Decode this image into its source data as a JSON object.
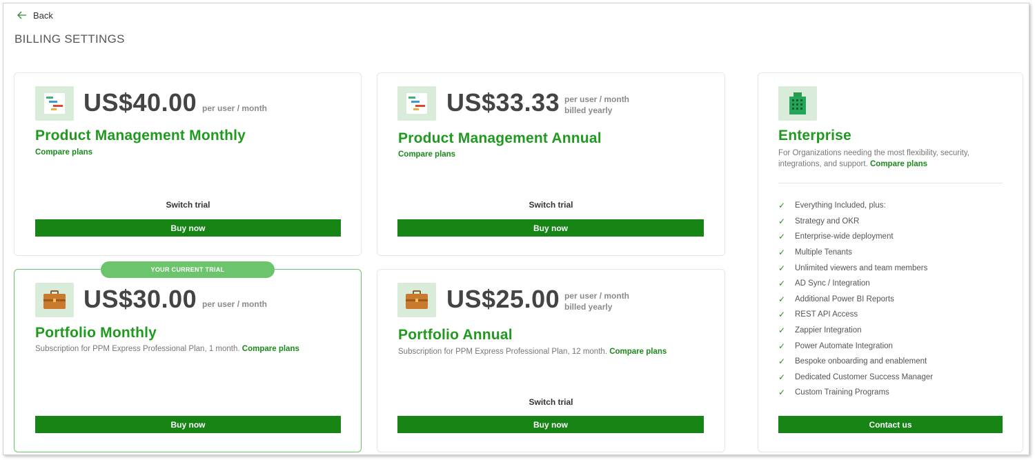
{
  "nav": {
    "back_label": "Back"
  },
  "page": {
    "title": "BILLING SETTINGS"
  },
  "cards": {
    "pm_monthly": {
      "price": "US$40.00",
      "per": "per user / month",
      "title": "Product Management Monthly",
      "compare": "Compare plans",
      "switch": "Switch trial",
      "buy": "Buy now",
      "icon": "gantt-chart-icon"
    },
    "pm_annual": {
      "price": "US$33.33",
      "per": "per user / month",
      "billed": "billed yearly",
      "title": "Product Management Annual",
      "compare": "Compare plans",
      "switch": "Switch trial",
      "buy": "Buy now",
      "icon": "gantt-chart-icon"
    },
    "portfolio_monthly": {
      "badge": "YOUR CURRENT TRIAL",
      "price": "US$30.00",
      "per": "per user / month",
      "title": "Portfolio Monthly",
      "desc": "Subscription for PPM Express Professional Plan, 1 month.",
      "compare": "Compare plans",
      "buy": "Buy now",
      "icon": "briefcase-icon"
    },
    "portfolio_annual": {
      "price": "US$25.00",
      "per": "per user / month",
      "billed": "billed yearly",
      "title": "Portfolio Annual",
      "desc": "Subscription for PPM Express Professional Plan, 12 month.",
      "compare": "Compare plans",
      "switch": "Switch trial",
      "buy": "Buy now",
      "icon": "briefcase-icon"
    },
    "enterprise": {
      "title": "Enterprise",
      "desc": "For Organizations needing the most flexibility, security, integrations, and support.",
      "compare": "Compare plans",
      "features": [
        "Everything Included, plus:",
        "Strategy and OKR",
        "Enterprise-wide deployment",
        "Multiple Tenants",
        "Unlimited viewers and team members",
        "AD Sync / Integration",
        "Additional Power BI Reports",
        "REST API Access",
        "Zappier Integration",
        "Power Automate Integration",
        "Bespoke onboarding and enablement",
        "Dedicated Customer Success Manager",
        "Custom Training Programs"
      ],
      "contact": "Contact us",
      "icon": "building-icon"
    }
  },
  "colors": {
    "accent": "#168516",
    "title_green": "#1f9a1f",
    "badge": "#6cc56c",
    "tile": "#d9ecd9"
  }
}
